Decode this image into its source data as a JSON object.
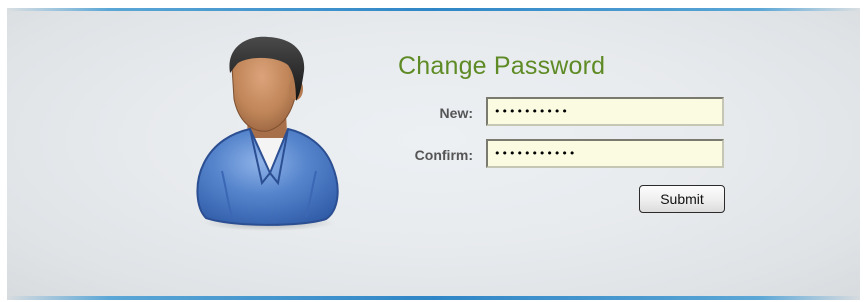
{
  "form": {
    "title": "Change Password",
    "new_label": "New:",
    "confirm_label": "Confirm:",
    "new_value": "••••••••••",
    "confirm_value": "•••••••••••",
    "submit_label": "Submit"
  },
  "colors": {
    "title": "#5e8b25",
    "field_background": "#fbfbe2",
    "accent_bar": "#2f86c6",
    "avatar_shirt": "#4d7fc8",
    "avatar_skin": "#c1875a"
  },
  "icons": {
    "avatar": "user-avatar-icon"
  }
}
